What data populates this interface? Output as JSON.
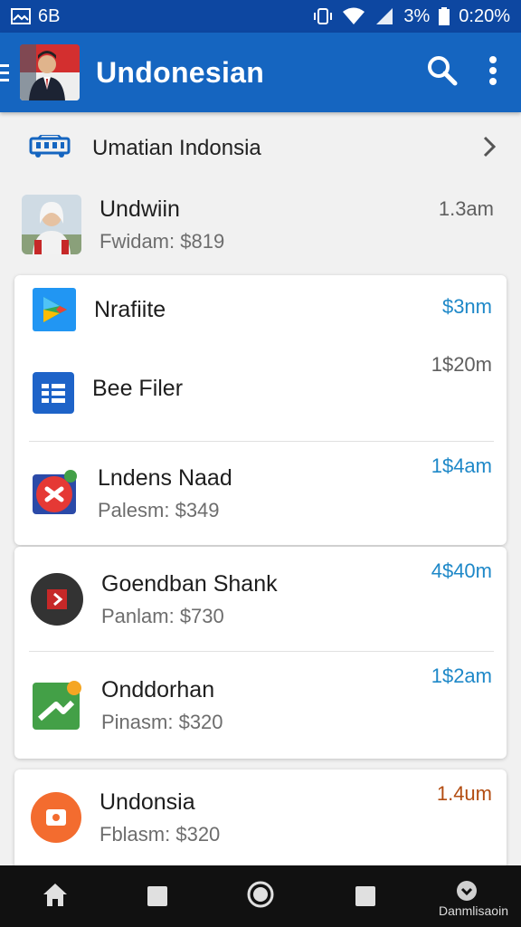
{
  "status_bar": {
    "left_text": "6B",
    "battery_text": "3%",
    "time": "0:20%"
  },
  "app_bar": {
    "title": "Undonesian",
    "icons": [
      "menu-icon",
      "avatar-image",
      "search-icon",
      "more-vert-icon"
    ]
  },
  "section": {
    "title": "Umatian Indonsia",
    "icon": "bus-icon"
  },
  "solo_item": {
    "title": "Undwiin",
    "subtitle": "Fwidam: $819",
    "time": "1.3am"
  },
  "card1": {
    "items": [
      {
        "title": "Nrafiite",
        "subtitle": "",
        "time": "$3nm",
        "icon": "play-store-icon"
      },
      {
        "title": "Bee Filer",
        "subtitle": "",
        "time": "1$20m",
        "icon": "sheets-icon"
      },
      {
        "title": "Lndens Naad",
        "subtitle": "Palesm: $349",
        "time": "1$4am",
        "icon": "red-badge-icon"
      }
    ]
  },
  "card2": {
    "items": [
      {
        "title": "Goendban Shank",
        "subtitle": "Panlam: $730",
        "time": "4$40m",
        "icon": "play-square-icon"
      },
      {
        "title": "Onddorhan",
        "subtitle": "Pinasm: $320",
        "time": "1$2am",
        "icon": "green-app-icon"
      }
    ]
  },
  "card3": {
    "items": [
      {
        "title": "Undonsia",
        "subtitle": "Fblasm: $320",
        "time": "1.4um",
        "icon": "orange-record-icon"
      }
    ]
  },
  "nav_bar": {
    "label": "Danmlisaoin",
    "buttons": [
      "home-icon",
      "square-icon",
      "circle-home-icon",
      "recents-icon",
      "assistant-icon"
    ]
  },
  "colors": {
    "app_bar": "#1565c0",
    "status_bar": "#0d47a1",
    "time_blue": "#1e88c8",
    "time_brown": "#b34d12"
  }
}
